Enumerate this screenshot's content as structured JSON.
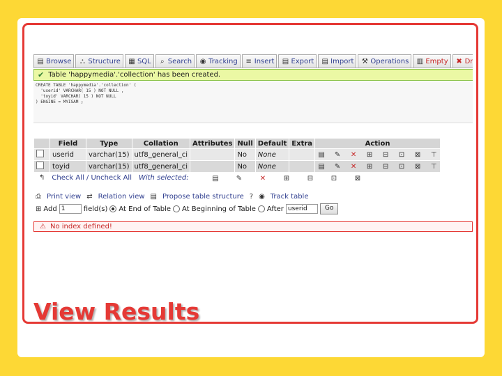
{
  "title": "View Results",
  "tabs": [
    {
      "label": "Browse",
      "icon": "browse-icon",
      "glyph": "▤"
    },
    {
      "label": "Structure",
      "icon": "structure-icon",
      "glyph": "⛬"
    },
    {
      "label": "SQL",
      "icon": "sql-icon",
      "glyph": "▦"
    },
    {
      "label": "Search",
      "icon": "search-icon",
      "glyph": "⌕"
    },
    {
      "label": "Tracking",
      "icon": "tracking-icon",
      "glyph": "◉"
    },
    {
      "label": "Insert",
      "icon": "insert-icon",
      "glyph": "≡"
    },
    {
      "label": "Export",
      "icon": "export-icon",
      "glyph": "▤"
    },
    {
      "label": "Import",
      "icon": "import-icon",
      "glyph": "▤"
    },
    {
      "label": "Operations",
      "icon": "operations-icon",
      "glyph": "⚒"
    },
    {
      "label": "Empty",
      "icon": "empty-icon",
      "glyph": "▥"
    },
    {
      "label": "Drop",
      "icon": "drop-icon",
      "glyph": "✖"
    }
  ],
  "notice": "Table 'happymedia'.'collection' has been created.",
  "sql": "CREATE TABLE 'happymedia'.'collection' (\n  'userid' VARCHAR( 15 ) NOT NULL ,\n  'toyid' VARCHAR( 15 ) NOT NULL\n) ENGINE = MYISAM ;",
  "table": {
    "headers": [
      "Field",
      "Type",
      "Collation",
      "Attributes",
      "Null",
      "Default",
      "Extra",
      "Action"
    ],
    "rows": [
      {
        "field": "userid",
        "type": "varchar(15)",
        "collation": "utf8_general_ci",
        "attributes": "",
        "null": "No",
        "default": "None",
        "extra": ""
      },
      {
        "field": "toyid",
        "type": "varchar(15)",
        "collation": "utf8_general_ci",
        "attributes": "",
        "null": "No",
        "default": "None",
        "extra": ""
      }
    ]
  },
  "check_all": "Check All / Uncheck All",
  "with_selected": "With selected:",
  "links": {
    "print_view": "Print view",
    "relation_view": "Relation view",
    "propose": "Propose table structure",
    "track": "Track table"
  },
  "add": {
    "label": "Add",
    "count": "1",
    "fields_suffix": "field(s)",
    "opt_end": "At End of Table",
    "opt_begin": "At Beginning of Table",
    "opt_after": "After",
    "after_value": "userid",
    "go": "Go"
  },
  "warning": "No index defined!",
  "colors": {
    "accent_red": "#E53935",
    "background": "#FDD835",
    "notice_bg": "#EBF8A4",
    "link": "#2F3E8F"
  }
}
